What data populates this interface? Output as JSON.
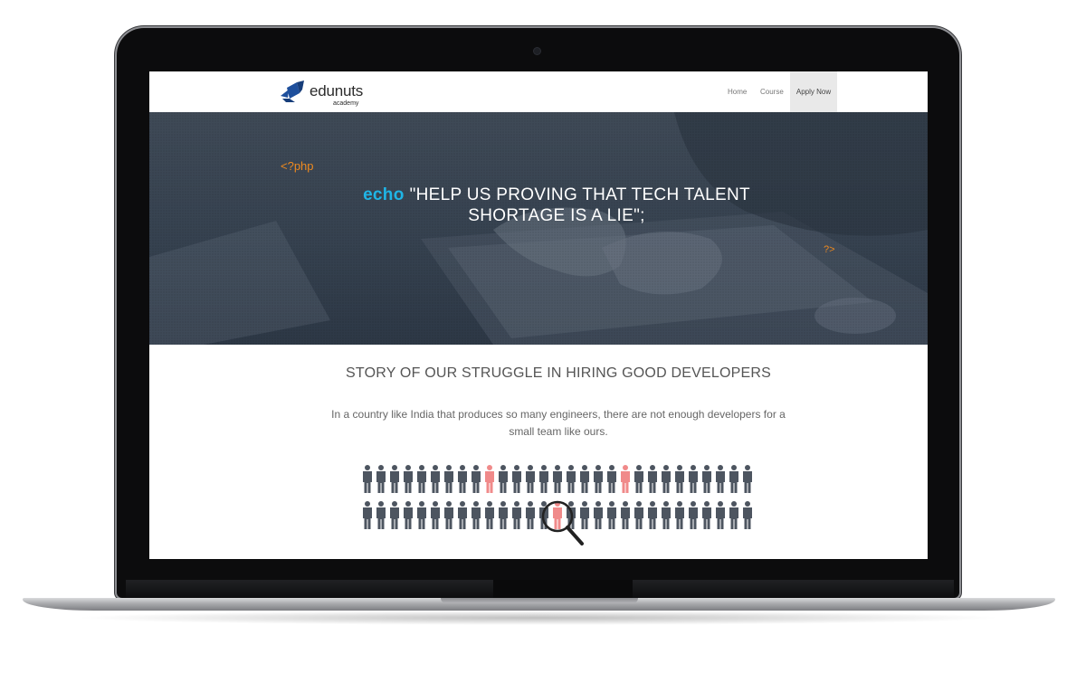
{
  "brand": {
    "name": "edunuts",
    "tagline": "academy",
    "logo_color": "#1e4f9c"
  },
  "nav": {
    "items": [
      {
        "label": "Home"
      },
      {
        "label": "Course"
      },
      {
        "label": "Apply Now",
        "active": true
      }
    ]
  },
  "hero": {
    "code_open": "<?php",
    "code_keyword": "echo",
    "quote": "\"HELP US PROVING THAT TECH TALENT SHORTAGE IS A LIE\";",
    "code_close": "?>",
    "keyword_color": "#1fb5e6",
    "tag_color": "#ee8a1f"
  },
  "story": {
    "title": "STORY OF OUR STRUGGLE IN HIRING GOOD DEVELOPERS",
    "text": "In a country like India that produces so many engineers, there are not enough developers for a small team like ours."
  },
  "illustration": {
    "icons": [
      "person-icon",
      "magnifier-icon"
    ],
    "figure_color": "#4d5560",
    "highlight_color": "#f08a8a"
  }
}
